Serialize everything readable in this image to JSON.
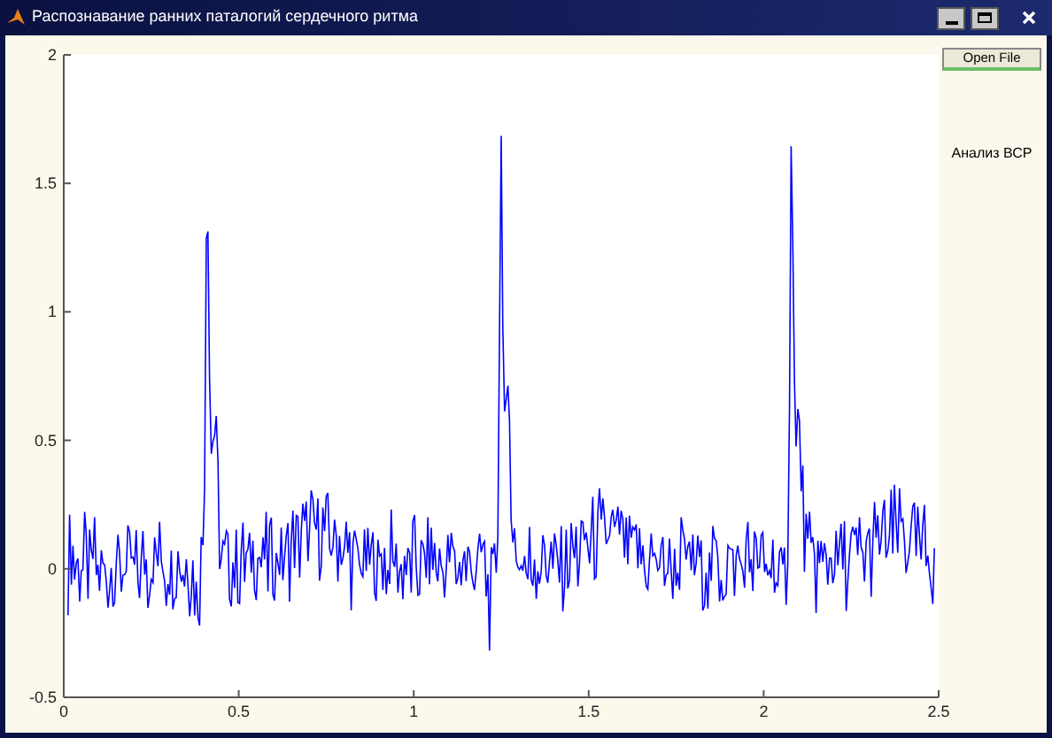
{
  "window": {
    "title": "Распознавание ранних паталогий сердечного ритма"
  },
  "controls": {
    "open_file_button": "Open File",
    "analysis_label": "Анализ ВСР"
  },
  "plot": {
    "y_ticks": [
      "2",
      "1.5",
      "1",
      "0.5",
      "0",
      "-0.5"
    ],
    "x_ticks": [
      "0",
      "0.5",
      "1",
      "1.5",
      "2",
      "2.5"
    ]
  }
}
